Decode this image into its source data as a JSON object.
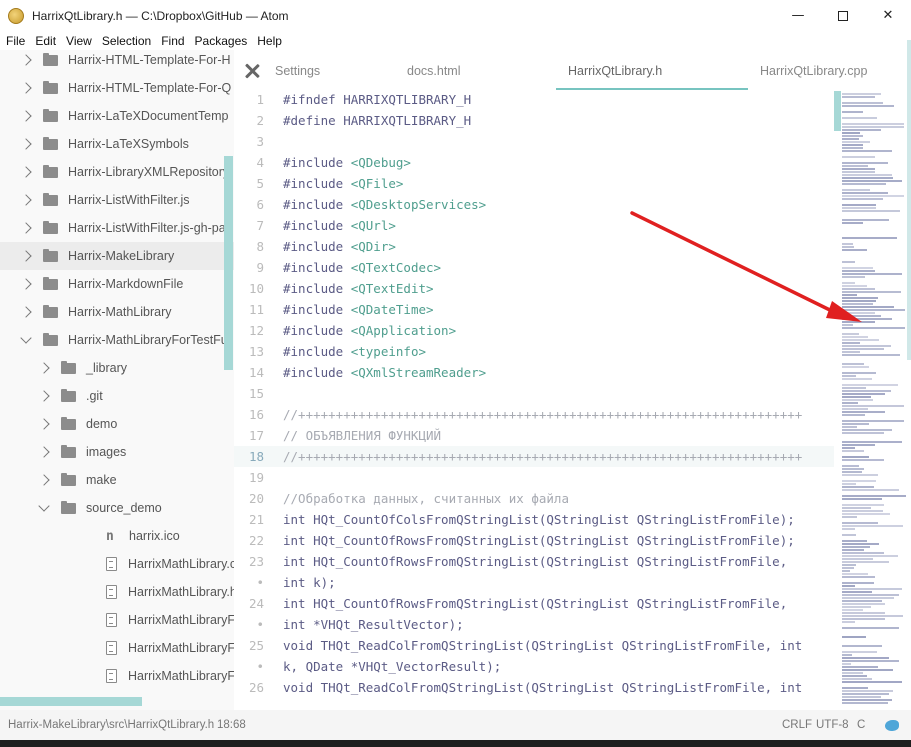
{
  "window": {
    "title": "HarrixQtLibrary.h — C:\\Dropbox\\GitHub — Atom",
    "minimize_glyph": "—",
    "close_glyph": "✕"
  },
  "menu": [
    "File",
    "Edit",
    "View",
    "Selection",
    "Find",
    "Packages",
    "Help"
  ],
  "tree": {
    "items": [
      {
        "label": "Harrix-HTML-Template-For-H",
        "type": "folder"
      },
      {
        "label": "Harrix-HTML-Template-For-Q",
        "type": "folder"
      },
      {
        "label": "Harrix-LaTeXDocumentTemp",
        "type": "folder"
      },
      {
        "label": "Harrix-LaTeXSymbols",
        "type": "folder"
      },
      {
        "label": "Harrix-LibraryXMLRepository",
        "type": "folder"
      },
      {
        "label": "Harrix-ListWithFilter.js",
        "type": "folder"
      },
      {
        "label": "Harrix-ListWithFilter.js-gh-pag",
        "type": "folder"
      },
      {
        "label": "Harrix-MakeLibrary",
        "type": "folder",
        "selected": true
      },
      {
        "label": "Harrix-MarkdownFile",
        "type": "folder"
      },
      {
        "label": "Harrix-MathLibrary",
        "type": "folder"
      },
      {
        "label": "Harrix-MathLibraryForTestFu",
        "type": "folder",
        "expanded": true
      },
      {
        "label": "_library",
        "type": "folder",
        "level": 1
      },
      {
        "label": ".git",
        "type": "folder",
        "level": 1
      },
      {
        "label": "demo",
        "type": "folder",
        "level": 1
      },
      {
        "label": "images",
        "type": "folder",
        "level": 1
      },
      {
        "label": "make",
        "type": "folder",
        "level": 1
      },
      {
        "label": "source_demo",
        "type": "folder",
        "level": 1,
        "expanded": true
      },
      {
        "label": "harrix.ico",
        "type": "ico",
        "level": 2
      },
      {
        "label": "HarrixMathLibrary.cpp",
        "type": "file",
        "level": 2
      },
      {
        "label": "HarrixMathLibrary.h",
        "type": "file",
        "level": 2
      },
      {
        "label": "HarrixMathLibraryForTe",
        "type": "file",
        "level": 2
      },
      {
        "label": "HarrixMathLibraryForTe",
        "type": "file",
        "level": 2
      },
      {
        "label": "HarrixMathLibraryForTe",
        "type": "file",
        "level": 2
      }
    ]
  },
  "tabs": [
    {
      "label": "Settings",
      "icon": "tools-icon"
    },
    {
      "label": "docs.html"
    },
    {
      "label": "HarrixQtLibrary.h",
      "active": true
    },
    {
      "label": "HarrixQtLibrary.cpp"
    }
  ],
  "editor": {
    "cursor_line": "18",
    "lines": [
      {
        "num": "1",
        "text": "#ifndef HARRIXQTLIBRARY_H",
        "kind": "kw"
      },
      {
        "num": "2",
        "text": "#define HARRIXQTLIBRARY_H",
        "kind": "kw"
      },
      {
        "num": "3",
        "text": "",
        "kind": "kw"
      },
      {
        "num": "4",
        "text": "#include ",
        "inc": "<QDebug>"
      },
      {
        "num": "5",
        "text": "#include ",
        "inc": "<QFile>"
      },
      {
        "num": "6",
        "text": "#include ",
        "inc": "<QDesktopServices>"
      },
      {
        "num": "7",
        "text": "#include ",
        "inc": "<QUrl>"
      },
      {
        "num": "8",
        "text": "#include ",
        "inc": "<QDir>"
      },
      {
        "num": "9",
        "text": "#include ",
        "inc": "<QTextCodec>"
      },
      {
        "num": "10",
        "text": "#include ",
        "inc": "<QTextEdit>"
      },
      {
        "num": "11",
        "text": "#include ",
        "inc": "<QDateTime>"
      },
      {
        "num": "12",
        "text": "#include ",
        "inc": "<QApplication>"
      },
      {
        "num": "13",
        "text": "#include ",
        "inc": "<typeinfo>"
      },
      {
        "num": "14",
        "text": "#include ",
        "inc": "<QXmlStreamReader>"
      },
      {
        "num": "15",
        "text": "",
        "kind": "kw"
      },
      {
        "num": "16",
        "text": "//+++++++++++++++++++++++++++++++++++++++++++++++++++++++++++++++++++",
        "kind": "cmt"
      },
      {
        "num": "17",
        "text": "// ОБЪЯВЛЕНИЯ ФУНКЦИЙ",
        "kind": "cmt"
      },
      {
        "num": "18",
        "text": "//+++++++++++++++++++++++++++++++++++++++++++++++++++++++++++++++++++",
        "kind": "cmt"
      },
      {
        "num": "19",
        "text": "",
        "kind": "kw"
      },
      {
        "num": "20",
        "text": "//Обработка данных, считанных их файла",
        "kind": "cmt"
      },
      {
        "num": "21",
        "text": "int HQt_CountOfColsFromQStringList(QStringList QStringListFromFile);",
        "kind": "kw"
      },
      {
        "num": "22",
        "text": "int HQt_CountOfRowsFromQStringList(QStringList QStringListFromFile);",
        "kind": "kw"
      },
      {
        "num": "23",
        "text": "int HQt_CountOfRowsFromQStringList(QStringList QStringListFromFile,",
        "kind": "kw"
      },
      {
        "num": "•",
        "text": "int k);",
        "kind": "kw"
      },
      {
        "num": "24",
        "text": "int HQt_CountOfRowsFromQStringList(QStringList QStringListFromFile,",
        "kind": "kw"
      },
      {
        "num": "•",
        "text": "int *VHQt_ResultVector);",
        "kind": "kw"
      },
      {
        "num": "25",
        "text": "void THQt_ReadColFromQStringList(QStringList QStringListFromFile, int",
        "kind": "kw"
      },
      {
        "num": "•",
        "text": "k, QDate *VHQt_VectorResult);",
        "kind": "kw"
      },
      {
        "num": "26",
        "text": "void THQt_ReadColFromQStringList(QStringList QStringListFromFile, int",
        "kind": "kw"
      }
    ]
  },
  "status": {
    "path": "Harrix-MakeLibrary\\src\\HarrixQtLibrary.h",
    "position": "18:68",
    "line_ending": "CRLF",
    "encoding": "UTF-8",
    "grammar": "C"
  },
  "icons": {
    "app": "atom-icon",
    "folder": "folder-icon",
    "file": "file-text-icon",
    "settings": "tools-icon",
    "status": "twitter-icon"
  },
  "colors": {
    "accent": "#77c4c0",
    "scrollbar": "#a6d8d6",
    "annotation_arrow": "#e02020"
  }
}
